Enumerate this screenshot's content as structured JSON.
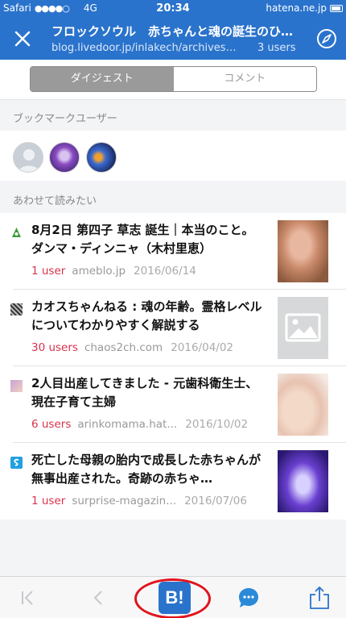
{
  "status_bar": {
    "carrier": "Safari",
    "signal": "●●●●○",
    "network": "4G",
    "time": "20:34",
    "site": "hatena.ne.jp"
  },
  "header": {
    "title": "フロックソウル　赤ちゃんと魂の誕生のひ…",
    "url": "blog.livedoor.jp/inlakech/archives/5...",
    "users": "3 users",
    "close_icon": "close-icon",
    "compass_icon": "compass-icon"
  },
  "tabs": [
    {
      "label": "ダイジェスト",
      "active": true
    },
    {
      "label": "コメント",
      "active": false
    }
  ],
  "sections": {
    "bookmark_users": "ブックマークユーザー",
    "related": "あわせて読みたい"
  },
  "related": [
    {
      "title": "8月2日 第四子 草志 誕生｜本当のこと。 ダンマ・ディンニャ（木村里恵）",
      "users": "1 user",
      "site": "ameblo.jp",
      "date": "2016/06/14"
    },
    {
      "title": "カオスちゃんねる : 魂の年齢。霊格レベルについてわかりやすく解説する",
      "users": "30 users",
      "site": "chaos2ch.com",
      "date": "2016/04/02"
    },
    {
      "title": "2人目出産してきました - 元歯科衛生士、現在子育て主婦",
      "users": "6 users",
      "site": "arinkomama.hat...",
      "date": "2016/10/02"
    },
    {
      "title": "死亡した母親の胎内で成長した赤ちゃんが無事出産された。奇跡の赤ちゃ…",
      "users": "1 user",
      "site": "surprise-magazin...",
      "date": "2016/07/06"
    }
  ],
  "toolbar": {
    "bookmark_label": "B!",
    "first_icon": "skip-back-icon",
    "back_icon": "back-chevron-icon",
    "comment_icon": "comment-bubble-icon",
    "share_icon": "share-icon"
  },
  "colors": {
    "accent": "#2a73cc",
    "user_count": "#d8324d",
    "highlight": "#e0131b"
  }
}
